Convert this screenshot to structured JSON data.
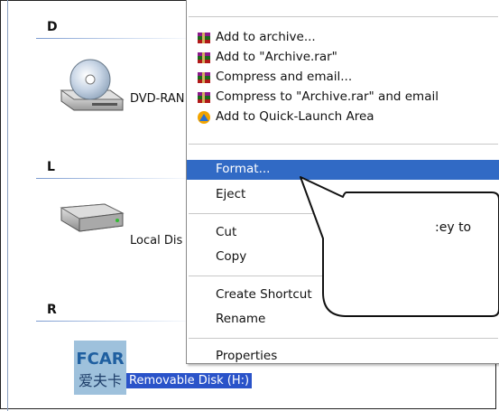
{
  "explorer": {
    "groups": [
      {
        "letter": "D"
      },
      {
        "letter": "L"
      },
      {
        "letter": "R"
      }
    ],
    "drives": [
      {
        "label": "DVD-RAN",
        "icon": "dvd-drive-icon"
      },
      {
        "label": "Local Dis",
        "icon": "hard-disk-icon"
      },
      {
        "label": "Removable Disk (H:)",
        "icon": "fcar-logo-icon",
        "selected": true
      }
    ],
    "logo_text": {
      "brand": "FCAR",
      "chinese": "爱夫卡"
    }
  },
  "context_menu": {
    "items": [
      {
        "label": "Add to archive...",
        "icon": "winrar-archive-icon"
      },
      {
        "label": "Add to \"Archive.rar\"",
        "icon": "winrar-archive-icon"
      },
      {
        "label": "Compress and email...",
        "icon": "winrar-archive-icon"
      },
      {
        "label": "Compress to \"Archive.rar\" and email",
        "icon": "winrar-archive-icon"
      },
      {
        "label": "Add to Quick-Launch Area",
        "icon": "quick-launch-icon"
      },
      {
        "label": "Format...",
        "highlighted": true
      },
      {
        "label": "Eject"
      },
      {
        "label": "Cut"
      },
      {
        "label": "Copy"
      },
      {
        "label": "Create Shortcut"
      },
      {
        "label": "Rename"
      },
      {
        "label": "Properties"
      }
    ]
  },
  "callout": {
    "text": ":ey to"
  },
  "colors": {
    "highlight": "#316ac5",
    "selection": "#2a53c9"
  }
}
